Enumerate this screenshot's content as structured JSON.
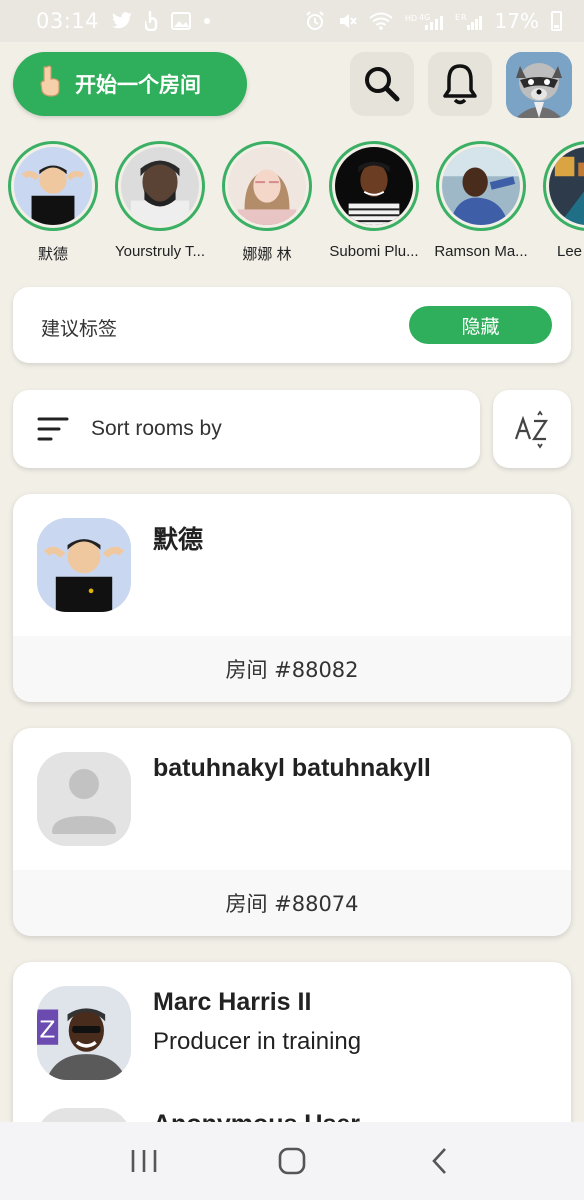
{
  "status_bar": {
    "time": "03:14",
    "battery": "17%",
    "left_icons": [
      "twitter-icon",
      "gesture-icon",
      "gallery-icon",
      "dot-icon"
    ],
    "right_icons": [
      "alarm-icon",
      "mute-icon",
      "wifi-icon",
      "hd-4g-signal-icon",
      "roaming-signal-icon",
      "battery-icon"
    ]
  },
  "header": {
    "start_room_label": "开始一个房间",
    "start_room_icon": "✌",
    "search_icon": "search-icon",
    "bell_icon": "bell-icon",
    "profile_icon": "raccoon-avatar"
  },
  "stories": [
    {
      "name": "默德"
    },
    {
      "name": "Yourstruly T..."
    },
    {
      "name": "娜娜 林"
    },
    {
      "name": "Subomi Plu..."
    },
    {
      "name": "Ramson Ma..."
    },
    {
      "name": "Lee"
    }
  ],
  "suggested": {
    "title": "建议标签",
    "hide_label": "隐藏"
  },
  "sort": {
    "label": "Sort rooms by",
    "az_label": "AZ"
  },
  "rooms": [
    {
      "host": "默德",
      "bio": "",
      "room_label": "房间 #88082"
    },
    {
      "host": "batuhnakyl batuhnakyll",
      "bio": "",
      "room_label": "房间 #88074"
    },
    {
      "host": "Marc Harris II",
      "bio": "Producer in training",
      "room_label": ""
    }
  ],
  "partial_room": {
    "host": "Anonymous User"
  },
  "colors": {
    "accent": "#2fae5b",
    "background": "#f1efe6",
    "card": "#ffffff"
  }
}
